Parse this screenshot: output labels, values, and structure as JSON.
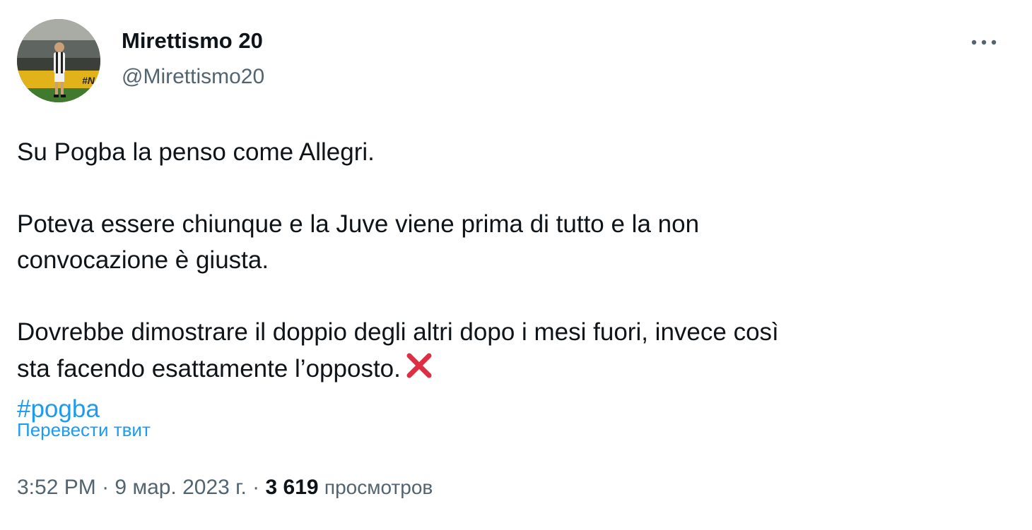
{
  "author": {
    "name": "Mirettismo 20",
    "handle": "@Mirettismo20",
    "avatar_icon": "avatar-photo-player-in-stadium"
  },
  "more_icon": "more-dots-icon",
  "tweet": {
    "line1": "Su Pogba la penso come Allegri.",
    "line2": "Poteva essere chiunque e la Juve viene prima di tutto e la non",
    "line3": "convocazione è giusta.",
    "line4": "Dovrebbe dimostrare il doppio degli altri dopo i mesi fuori, invece così",
    "line5": "sta facendo esattamente l’opposto.",
    "emoji": "cross-mark-icon",
    "hashtag": "#pogba"
  },
  "translate_label": "Перевести твит",
  "meta": {
    "time": "3:52 PM",
    "separator": "·",
    "date": "9 мар. 2023 г.",
    "views_count": "3 619",
    "views_label": "просмотров"
  },
  "colors": {
    "text": "#0f1419",
    "secondary": "#536471",
    "link": "#1d9bf0",
    "cross": "#dd2e44"
  }
}
